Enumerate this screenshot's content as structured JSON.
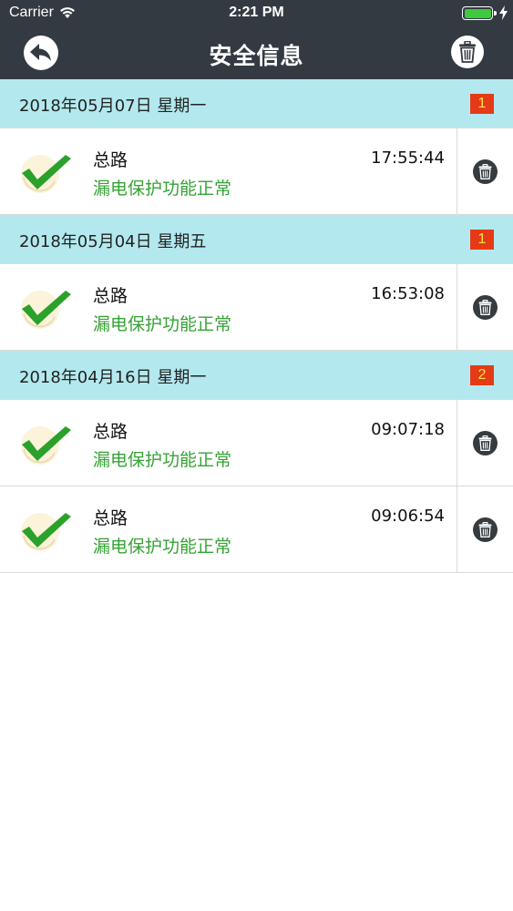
{
  "status_bar": {
    "carrier": "Carrier",
    "time": "2:21 PM"
  },
  "nav": {
    "title": "安全信息",
    "back_icon": "back-arrow-icon",
    "action_icon": "trash-icon"
  },
  "colors": {
    "nav_bg": "#343a42",
    "section_bg": "#b3e9ee",
    "badge_bg": "#e53a16",
    "badge_text": "#ffe243",
    "status_green": "#35a335"
  },
  "sections": [
    {
      "date": "2018年05月07日 星期一",
      "count": "1",
      "items": [
        {
          "name": "总路",
          "status": "漏电保护功能正常",
          "time": "17:55:44"
        }
      ]
    },
    {
      "date": "2018年05月04日 星期五",
      "count": "1",
      "items": [
        {
          "name": "总路",
          "status": "漏电保护功能正常",
          "time": "16:53:08"
        }
      ]
    },
    {
      "date": "2018年04月16日 星期一",
      "count": "2",
      "items": [
        {
          "name": "总路",
          "status": "漏电保护功能正常",
          "time": "09:07:18"
        },
        {
          "name": "总路",
          "status": "漏电保护功能正常",
          "time": "09:06:54"
        }
      ]
    }
  ]
}
